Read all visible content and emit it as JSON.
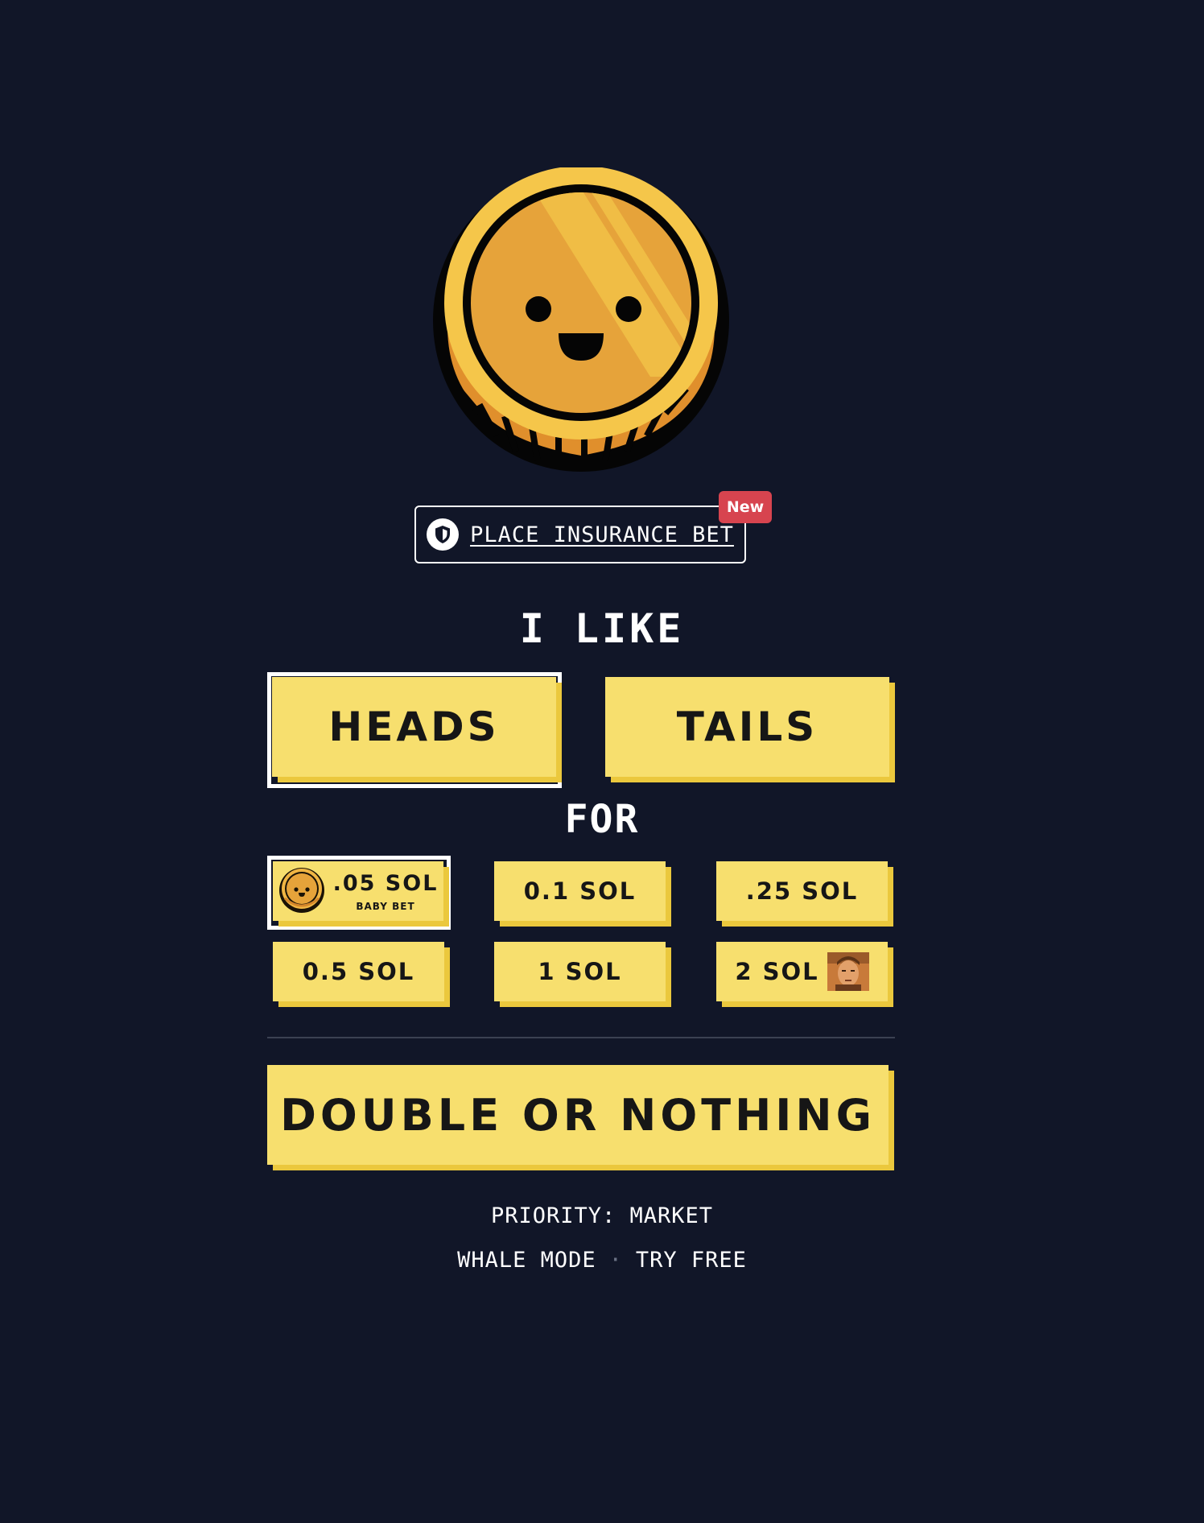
{
  "insurance": {
    "label": "PLACE INSURANCE BET",
    "badge": "New",
    "icon": "shield-icon"
  },
  "prompt": {
    "i_like": "I LIKE",
    "for": "FOR"
  },
  "sides": {
    "heads": "HEADS",
    "tails": "TAILS",
    "selected": "HEADS"
  },
  "amounts": [
    {
      "label": ".05 SOL",
      "sublabel": "BABY BET",
      "icon": "coin-icon",
      "selected": true
    },
    {
      "label": "0.1 SOL"
    },
    {
      "label": ".25 SOL"
    },
    {
      "label": "0.5 SOL"
    },
    {
      "label": "1 SOL"
    },
    {
      "label": "2 SOL",
      "icon": "portrait-icon"
    }
  ],
  "action": {
    "label": "DOUBLE OR NOTHING"
  },
  "footer": {
    "priority": "PRIORITY: MARKET",
    "whale_mode": "WHALE MODE",
    "separator": "·",
    "try_free": "TRY FREE"
  },
  "colors": {
    "background": "#111628",
    "button_yellow": "#f7df6e",
    "button_shadow": "#ebc83d",
    "coin_gold": "#f5c64a",
    "badge_red": "#d7444f"
  }
}
